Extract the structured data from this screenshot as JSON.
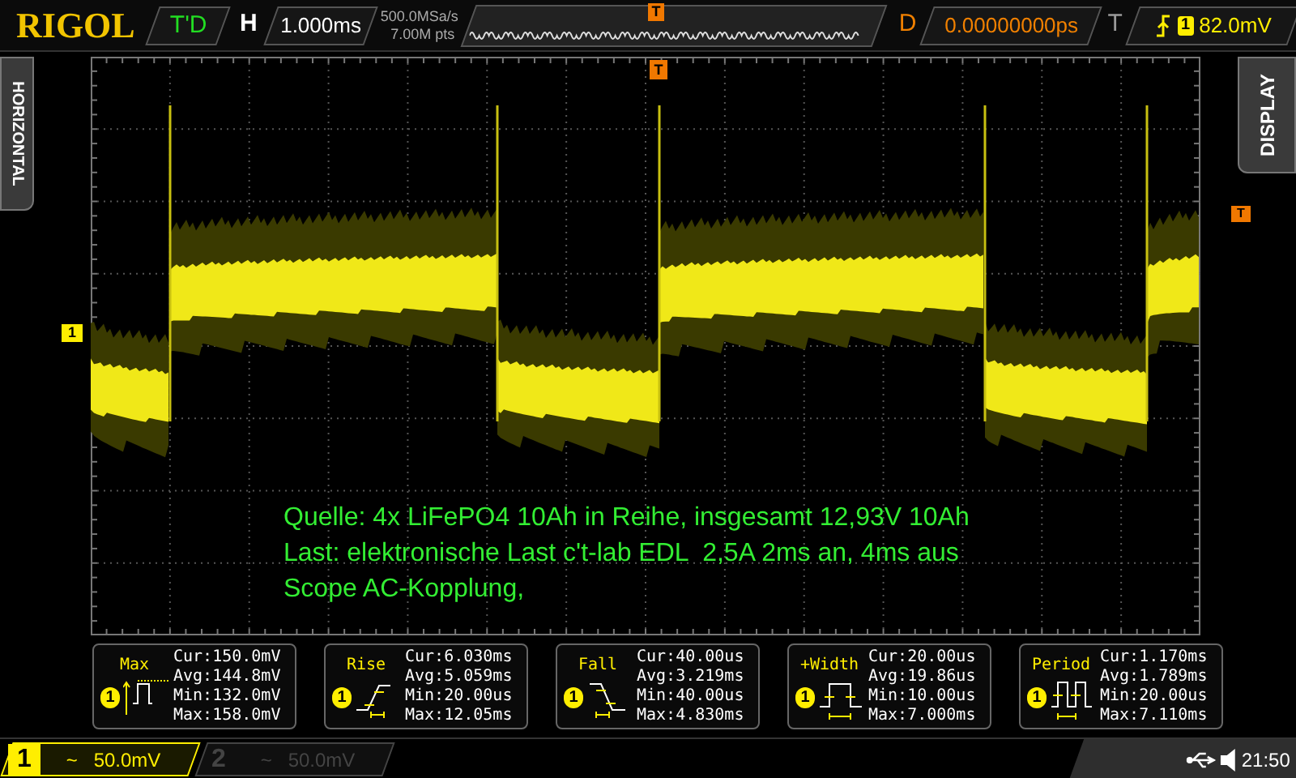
{
  "top_bar": {
    "brand": "RIGOL",
    "run_status": "T'D",
    "horizontal_label": "H",
    "timebase": "1.000ms",
    "sample_rate": "500.0MSa/s",
    "memory_depth": "7.00M pts",
    "memory_trigger_marker": "T",
    "delay_label": "D",
    "delay": "0.00000000ps",
    "trigger_label": "T",
    "trigger_channel": "1",
    "trigger_level": "82.0mV"
  },
  "side_tabs": {
    "left": "HORIZONTAL",
    "right": "DISPLAY"
  },
  "screen": {
    "channel_marker": "1",
    "trigger_position_marker": "T",
    "trigger_level_marker": "T",
    "notes": [
      "Quelle: 4x LiFePO4 10Ah in Reihe, insgesamt 12,93V 10Ah",
      "Last: elektronische Last c't-lab EDL  2,5A 2ms an, 4ms aus",
      "Scope AC-Kopplung,"
    ]
  },
  "measurements": [
    {
      "kind": "max",
      "label": "Max",
      "channel": "1",
      "lines": [
        "Cur:150.0mV",
        "Avg:144.8mV",
        "Min:132.0mV",
        "Max:158.0mV"
      ]
    },
    {
      "kind": "rise",
      "label": "Rise",
      "channel": "1",
      "lines": [
        "Cur:6.030ms",
        "Avg:5.059ms",
        "Min:20.00us",
        "Max:12.05ms"
      ]
    },
    {
      "kind": "fall",
      "label": "Fall",
      "channel": "1",
      "lines": [
        "Cur:40.00us",
        "Avg:3.219ms",
        "Min:40.00us",
        "Max:4.830ms"
      ]
    },
    {
      "kind": "pwidth",
      "label": "+Width",
      "channel": "1",
      "lines": [
        "Cur:20.00us",
        "Avg:19.86us",
        "Min:10.00us",
        "Max:7.000ms"
      ]
    },
    {
      "kind": "period",
      "label": "Period",
      "channel": "1",
      "lines": [
        "Cur:1.170ms",
        "Avg:1.789ms",
        "Min:20.00us",
        "Max:7.110ms"
      ]
    }
  ],
  "channels": [
    {
      "number": "1",
      "coupling": "~",
      "scale": "50.0mV",
      "on": true
    },
    {
      "number": "2",
      "coupling": "~",
      "scale": "50.0mV",
      "on": false
    }
  ],
  "status_bar": {
    "time": "21:50"
  }
}
